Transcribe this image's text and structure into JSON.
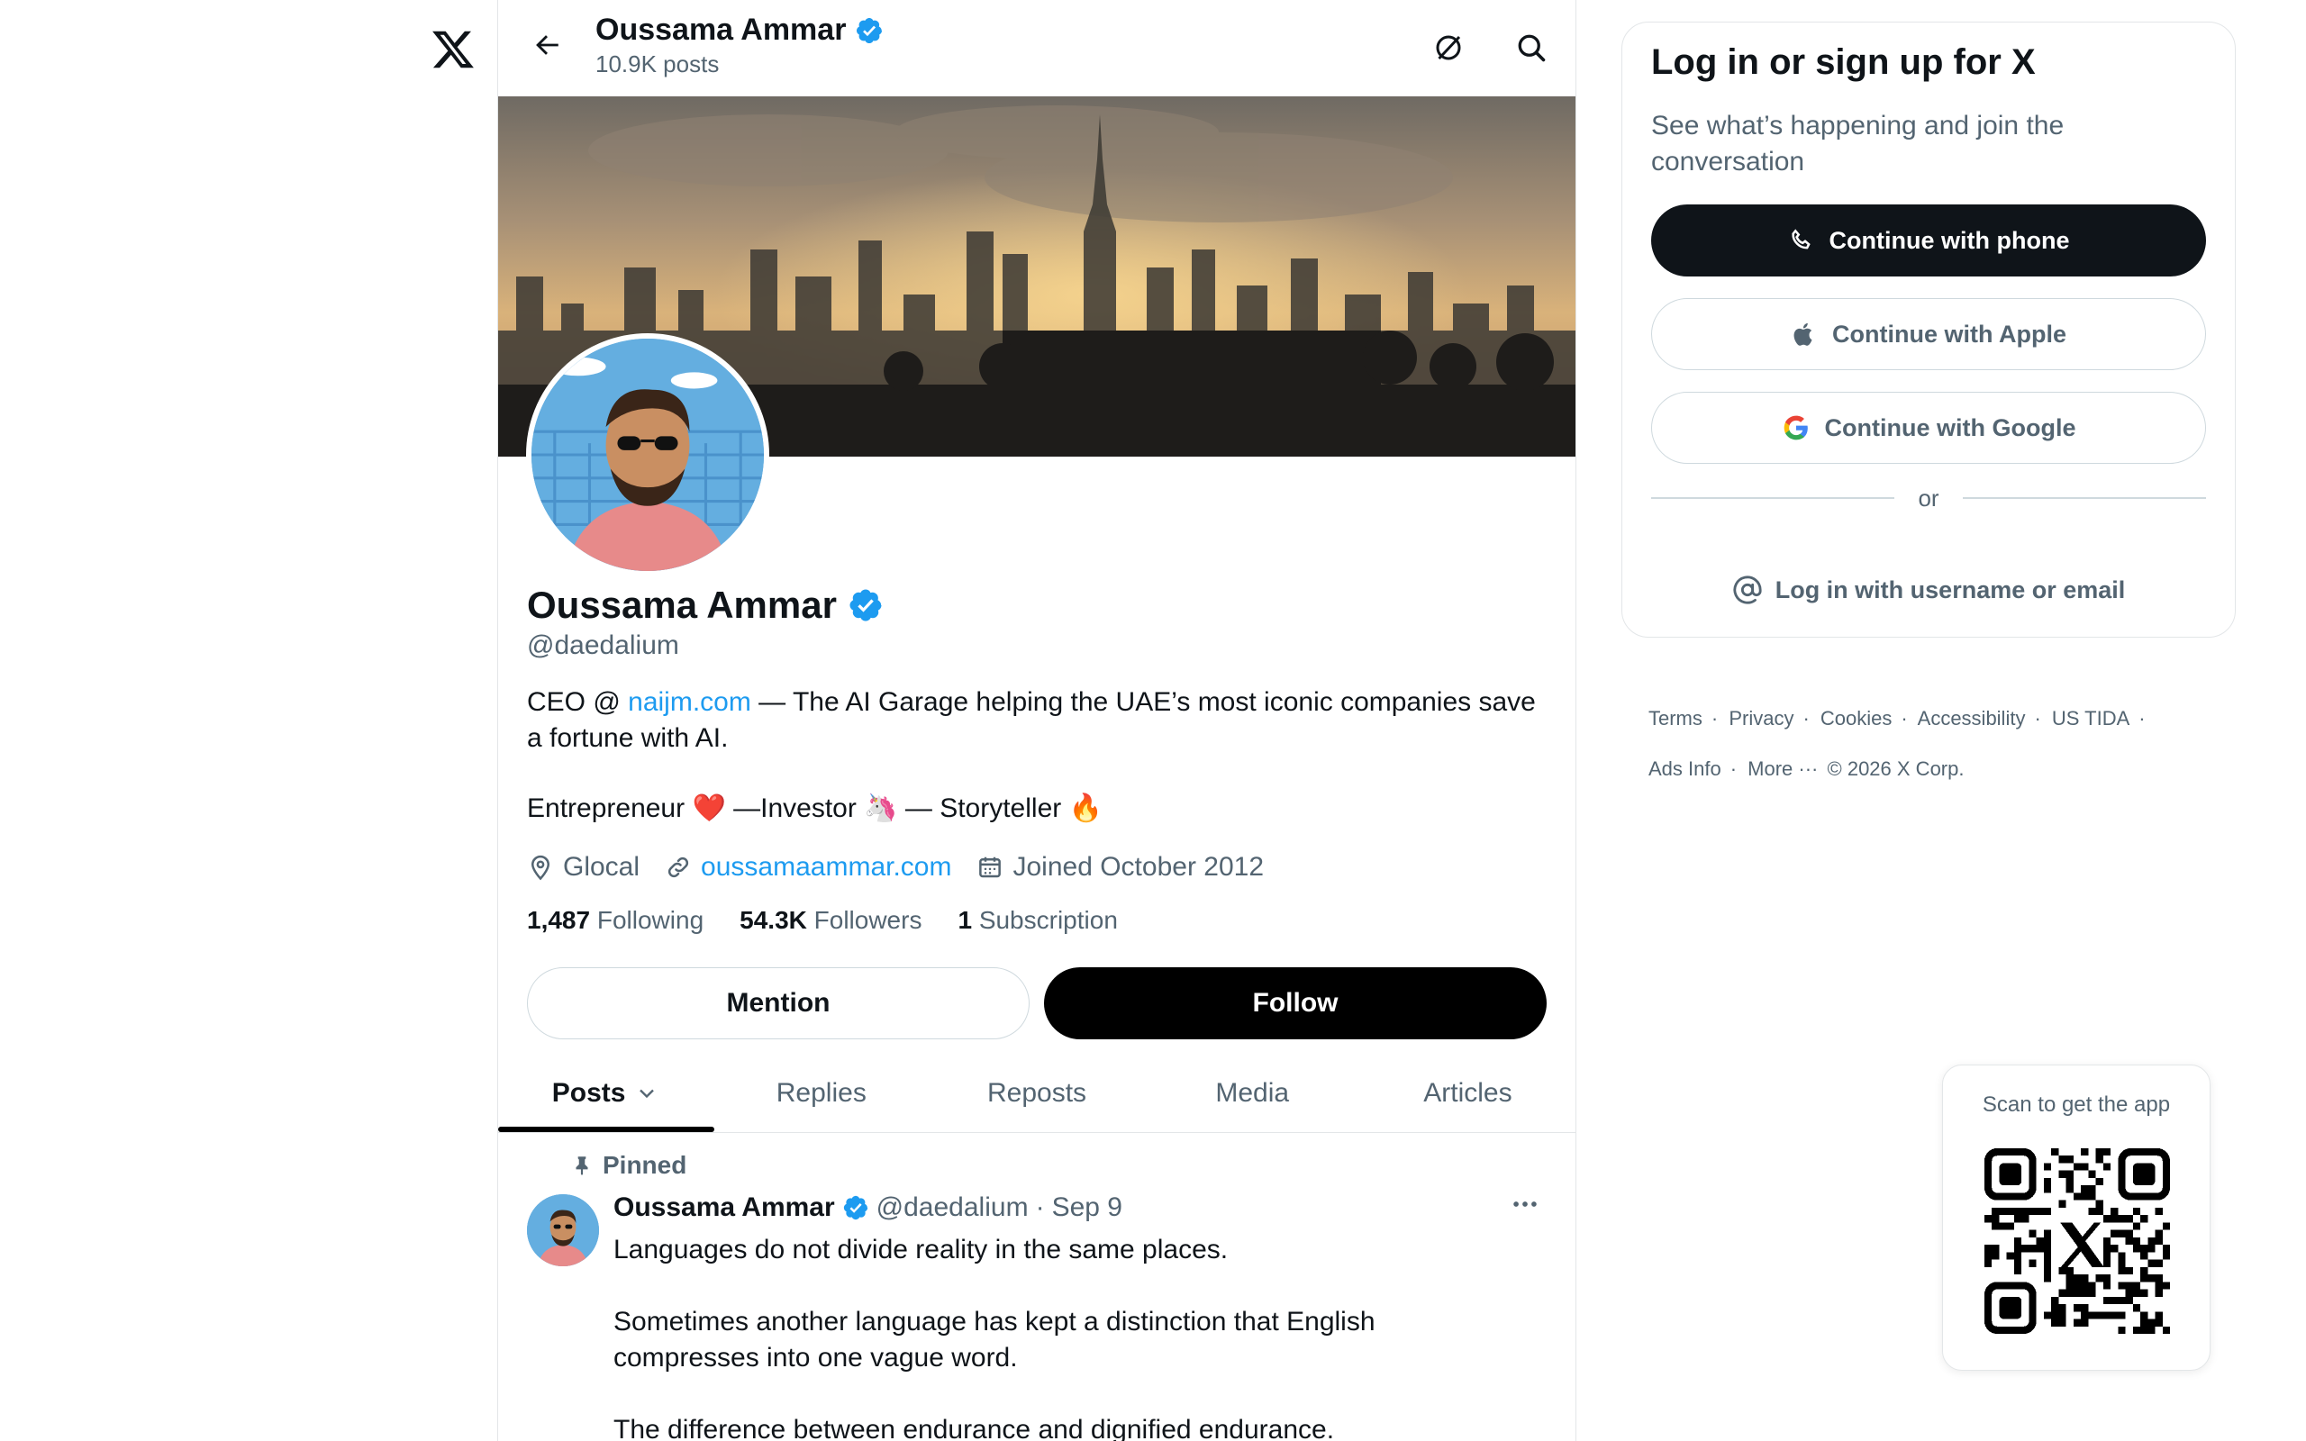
{
  "colors": {
    "accent": "#1d9bf0",
    "text": "#0f1419",
    "muted": "#536471",
    "border": "#e3e6e8",
    "dark_button": "#0f1419"
  },
  "topbar": {
    "name": "Oussama Ammar",
    "posts_count": "10.9K posts"
  },
  "profile": {
    "name": "Oussama Ammar",
    "handle": "@daedalium",
    "bio_prefix": "CEO @ ",
    "bio_link": "naijm.com",
    "bio_rest": " — The AI Garage helping the UAE’s most iconic companies save a fortune with AI.",
    "bio_line2": "Entrepreneur ❤️ —Investor 🦄 — Storyteller 🔥",
    "location": "Glocal",
    "website": "oussamaammar.com",
    "joined": "Joined October 2012",
    "following_count": "1,487",
    "following_label": "Following",
    "followers_count": "54.3K",
    "followers_label": "Followers",
    "subscription_count": "1",
    "subscription_label": "Subscription",
    "mention_label": "Mention",
    "follow_label": "Follow"
  },
  "tabs": [
    {
      "label": "Posts"
    },
    {
      "label": "Replies"
    },
    {
      "label": "Reposts"
    },
    {
      "label": "Media"
    },
    {
      "label": "Articles"
    }
  ],
  "post": {
    "pinned_label": "Pinned",
    "author": "Oussama Ammar",
    "handle": "@daedalium",
    "dot": "·",
    "date": "Sep 9",
    "body": "Languages do not divide reality in the same places.\n\nSometimes another language has kept a distinction that English\ncompresses into one vague word.\n\nThe difference between endurance and dignified endurance."
  },
  "login": {
    "title": "Log in or sign up for X",
    "subtitle": "See what’s happening and join the conversation",
    "phone_label": "Continue with phone",
    "apple_label": "Continue with Apple",
    "google_label": "Continue with Google",
    "or_label": "or",
    "username_label": "Log in with username or email"
  },
  "footer": {
    "links": [
      "Terms",
      "Privacy",
      "Cookies",
      "Accessibility",
      "US TIDA"
    ],
    "ads_info": "Ads Info",
    "more": "More ···",
    "copyright": "© 2026 X Corp."
  },
  "qr": {
    "label": "Scan to get the app"
  },
  "icons": [
    "x-logo-icon",
    "back-arrow-icon",
    "grok-icon",
    "search-icon",
    "verified-badge-icon",
    "location-icon",
    "link-icon",
    "calendar-icon",
    "chevron-down-icon",
    "pin-icon",
    "more-icon",
    "phone-icon",
    "apple-icon",
    "google-icon",
    "at-icon"
  ]
}
